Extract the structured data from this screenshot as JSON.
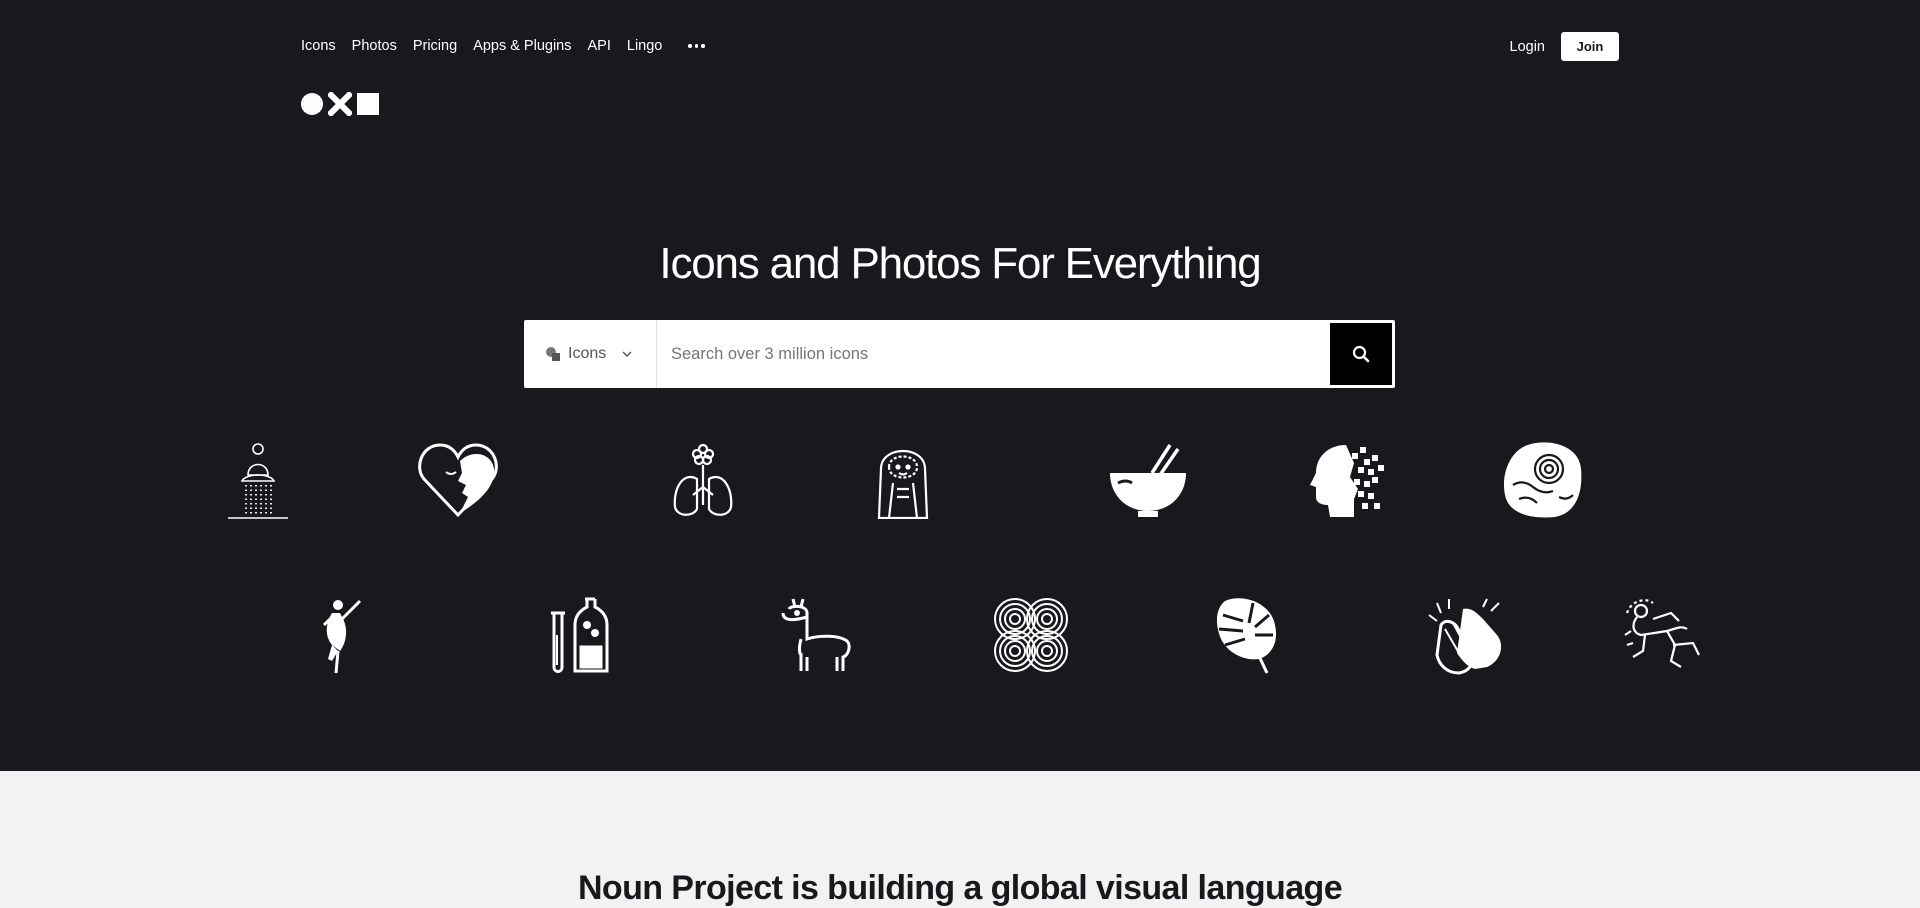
{
  "nav": {
    "items": [
      {
        "label": "Icons"
      },
      {
        "label": "Photos"
      },
      {
        "label": "Pricing"
      },
      {
        "label": "Apps & Plugins"
      },
      {
        "label": "API"
      },
      {
        "label": "Lingo"
      }
    ],
    "more_icon": "ellipsis-icon",
    "login_label": "Login",
    "join_label": "Join"
  },
  "logo": {
    "icons": [
      "circle-icon",
      "cross-icon",
      "square-icon"
    ]
  },
  "hero": {
    "title": "Icons and Photos For Everything"
  },
  "search": {
    "type_label": "Icons",
    "type_icon": "icons-type-icon",
    "placeholder": "Search over 3 million icons",
    "button_icon": "search-icon"
  },
  "featured_icons": [
    "meditating-figure-icon",
    "heart-face-icon",
    "flower-lungs-icon",
    "hooded-woman-icon",
    "bowl-chopsticks-icon",
    "pixel-head-icon",
    "fossil-rock-icon",
    "dancer-icon",
    "test-tubes-icon",
    "llama-icon",
    "infinity-spiral-icon",
    "monstera-leaf-icon",
    "clapping-hands-icon",
    "juggler-icon"
  ],
  "mission": {
    "title": "Noun Project is building a global visual language"
  },
  "colors": {
    "hero_bg": "#18191d",
    "page_bg": "#f1f2f1",
    "accent": "#000000"
  }
}
